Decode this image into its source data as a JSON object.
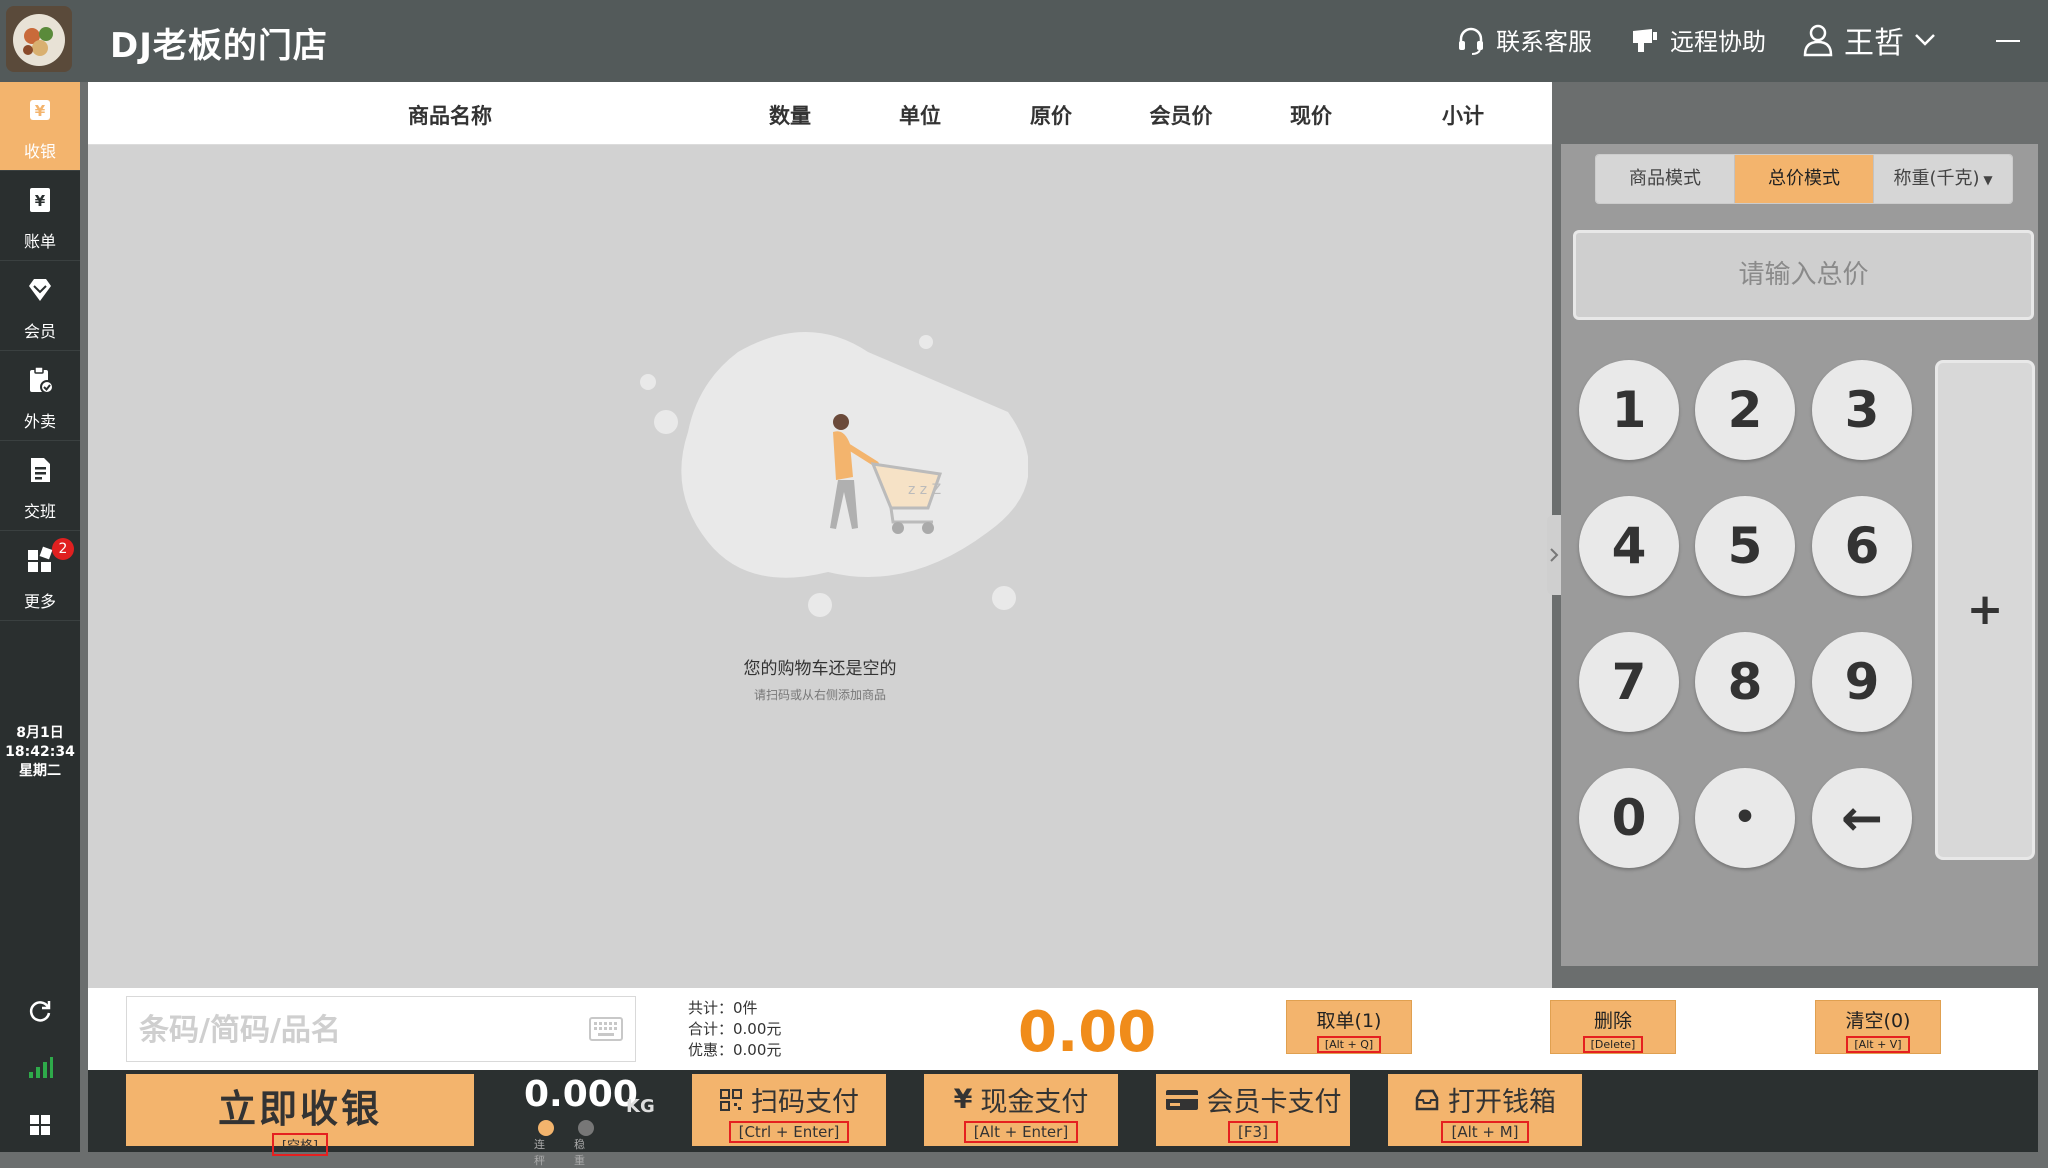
{
  "header": {
    "store_name": "DJ老板的门店",
    "support_label": "联系客服",
    "remote_label": "远程协助",
    "user_name": "王哲"
  },
  "sidebar": {
    "items": [
      {
        "label": "收银",
        "icon": "cash-register-icon",
        "active": true
      },
      {
        "label": "账单",
        "icon": "bill-icon",
        "active": false
      },
      {
        "label": "会员",
        "icon": "member-diamond-icon",
        "active": false
      },
      {
        "label": "外卖",
        "icon": "takeout-clipboard-icon",
        "active": false
      },
      {
        "label": "交班",
        "icon": "shift-handover-icon",
        "active": false
      },
      {
        "label": "更多",
        "icon": "more-grid-icon",
        "active": false,
        "badge": "2"
      }
    ],
    "date": "8月1日",
    "time": "18:42:34",
    "weekday": "星期二"
  },
  "table": {
    "columns": [
      "商品名称",
      "数量",
      "单位",
      "原价",
      "会员价",
      "现价",
      "小计"
    ]
  },
  "empty_state": {
    "title": "您的购物车还是空的",
    "subtitle": "请扫码或从右侧添加商品"
  },
  "right_panel": {
    "mode_tabs": [
      "商品模式",
      "总价模式",
      "称重(千克)"
    ],
    "active_tab": "总价模式",
    "total_placeholder": "请输入总价",
    "keys": [
      "1",
      "2",
      "3",
      "4",
      "5",
      "6",
      "7",
      "8",
      "9",
      "0",
      "•",
      "←"
    ],
    "plus_key": "+"
  },
  "bottom": {
    "barcode_placeholder": "条码/简码/品名",
    "count_text": "共计：0件",
    "sum_text": "合计：0.00元",
    "discount_text": "优惠：0.00元",
    "total_amount": "0.00",
    "take_order": {
      "label": "取单(1)",
      "key": "[Alt + Q]"
    },
    "delete": {
      "label": "删除",
      "key": "[Delete]"
    },
    "clear": {
      "label": "清空(0)",
      "key": "[Alt + V]"
    },
    "checkout": {
      "label": "立即收银",
      "key": "[空格]"
    },
    "weight_value": "0.000",
    "weight_unit": "KG",
    "scale_connected_label": "连秤",
    "scale_stable_label": "稳重",
    "scan_pay": {
      "label": "扫码支付",
      "key": "[Ctrl + Enter]"
    },
    "cash_pay": {
      "label": "现金支付",
      "key": "[Alt + Enter]"
    },
    "card_pay": {
      "label": "会员卡支付",
      "key": "[F3]"
    },
    "open_drawer": {
      "label": "打开钱箱",
      "key": "[Alt + M]"
    }
  },
  "colors": {
    "accent": "#f3b46d",
    "total_orange": "#f08c1a",
    "sidebar_bg": "#2a2f2f",
    "topbar_bg": "#535a5a",
    "badge_red": "#e02020"
  }
}
